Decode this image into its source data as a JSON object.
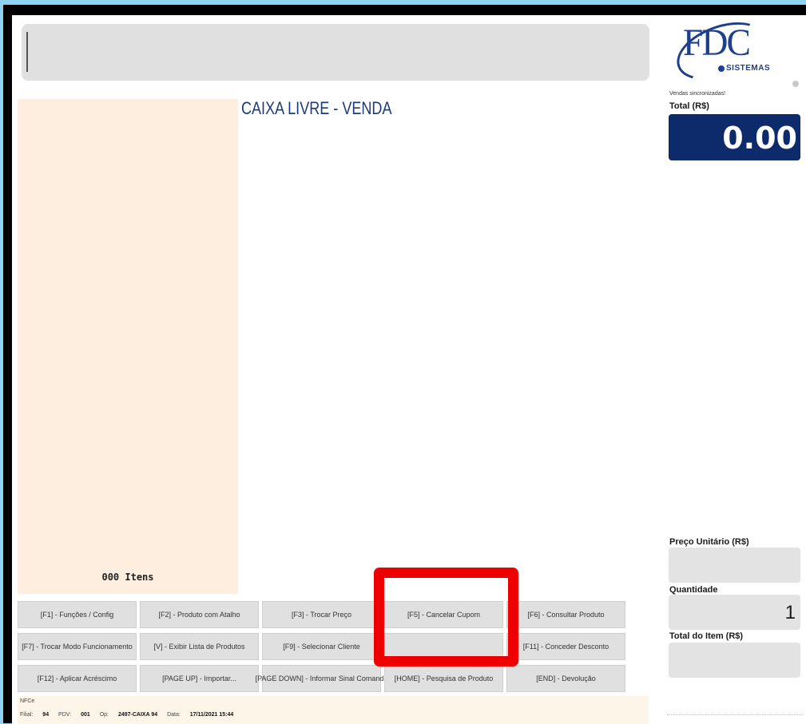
{
  "header": {
    "search_value": "",
    "logo_main": "FDC",
    "logo_sub": "SISTEMAS",
    "sync_status": "Vendas sincronizadas!"
  },
  "main": {
    "title": "CAIXA LIVRE - VENDA",
    "items_count": "000 Itens"
  },
  "totals": {
    "total_label": "Total (R$)",
    "total_value": "0.00",
    "unit_price_label": "Preço Unitário (R$)",
    "unit_price_value": "",
    "quantity_label": "Quantidade",
    "quantity_value": "1",
    "item_total_label": "Total do Item (R$)",
    "item_total_value": ""
  },
  "function_keys": [
    [
      "[F1] - Funções / Config",
      "[F2] - Produto com Atalho",
      "[F3] - Trocar Preço",
      "[F5] - Cancelar Cupom",
      "[F6] - Consultar Produto"
    ],
    [
      "[F7] - Trocar Modo Funcionamento",
      "[V] - Exibir Lista de Produtos",
      "[F9] - Selecionar Cliente",
      "",
      "[F11] - Conceder Desconto"
    ],
    [
      "[F12] - Aplicar Acréscimo",
      "[PAGE UP] - Importar...",
      "[PAGE DOWN] - Informar Sinal Comanda",
      "[HOME] - Pesquisa de Produto",
      "[END] - Devolução"
    ]
  ],
  "footer": {
    "mode": "NFCe",
    "filial_label": "Filial:",
    "filial": "94",
    "pdv_label": "PDV:",
    "pdv": "001",
    "op_label": "Op:",
    "op": "2497-CAIXA 94",
    "date_label": "Data:",
    "date": "17/11/2021 15:44"
  },
  "colors": {
    "total_bg": "#0d2a6b",
    "highlight": "#ee0000",
    "items_panel": "#fdeee0",
    "title": "#1d3a7a"
  }
}
